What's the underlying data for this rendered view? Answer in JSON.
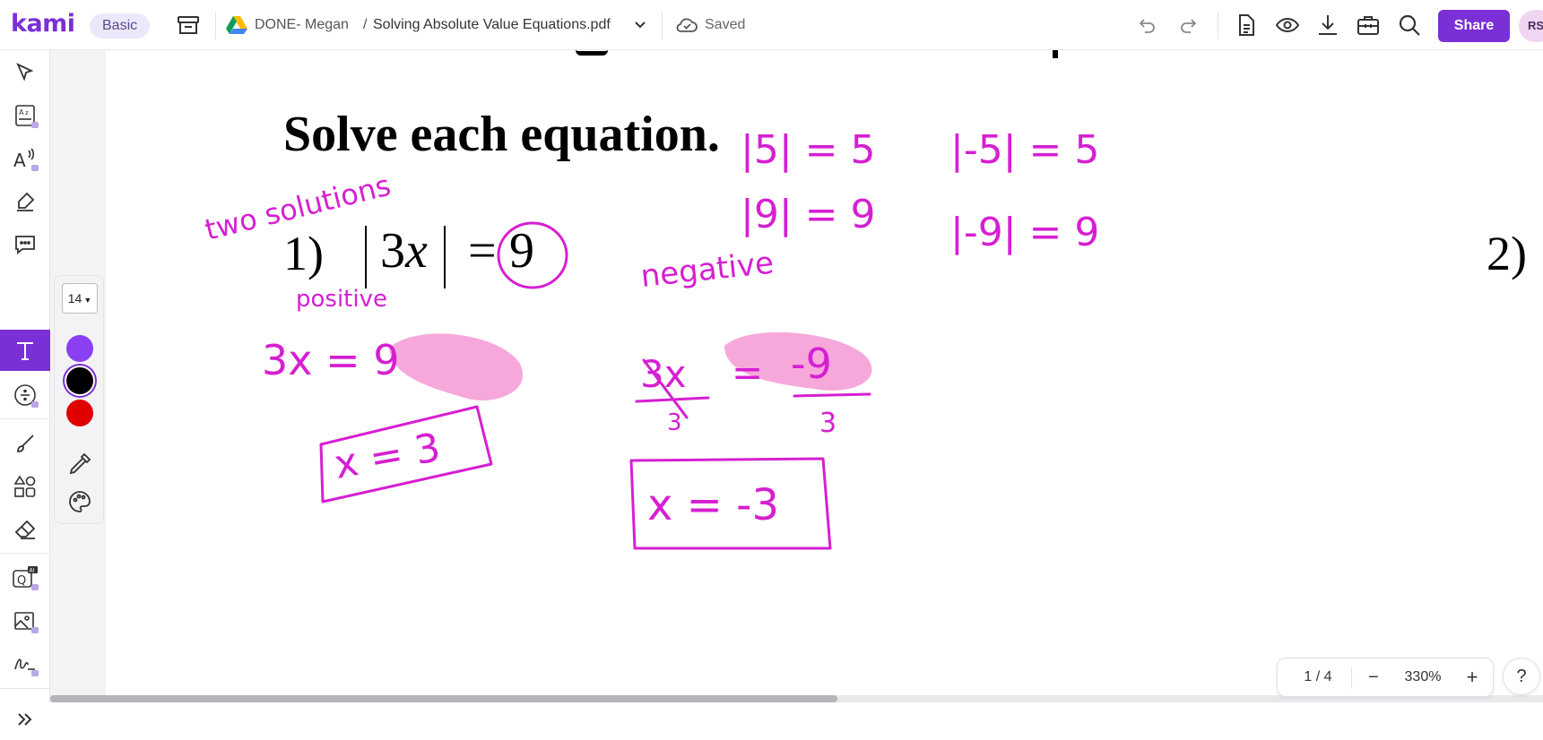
{
  "app": {
    "logo": "kami",
    "plan": "Basic"
  },
  "breadcrumb": {
    "folder": "DONE- Megan",
    "separator": "/",
    "file": "Solving Absolute Value Equations.pdf"
  },
  "status": {
    "saved": "Saved"
  },
  "header_actions": {
    "share_label": "Share",
    "avatar_initials": "RS",
    "icons": [
      "undo-icon",
      "redo-icon",
      "document-icon",
      "eye-icon",
      "download-icon",
      "toolbox-icon",
      "search-icon"
    ]
  },
  "left_toolbar": {
    "active": "text-tool",
    "items": [
      "select-tool",
      "dictionary-tool",
      "read-aloud-tool",
      "markup-tool",
      "comment-tool",
      "text-tool",
      "equation-tool",
      "draw-tool",
      "shapes-tool",
      "eraser-tool",
      "ai-question-tool",
      "image-tool",
      "signature-tool",
      "expand-toolbar"
    ]
  },
  "text_options": {
    "font_size": "14",
    "colors": [
      {
        "name": "purple",
        "hex": "#8a3ff0"
      },
      {
        "name": "black",
        "hex": "#000000",
        "selected": true
      },
      {
        "name": "red",
        "hex": "#e00000"
      }
    ]
  },
  "document": {
    "heading": "Solve each equation.",
    "problem1": {
      "number": "1)",
      "expr_coef": "3",
      "expr_var": "x",
      "eq": "=",
      "rhs": "9"
    },
    "problem2": {
      "number": "2)"
    },
    "ink_color": "#d61fd2",
    "highlight_color": "#f7a8da",
    "handwriting": {
      "two_solutions": "two solutions",
      "abs_examples": [
        "|5| = 5",
        "|-5| = 5",
        "|9| = 9",
        "|-9| = 9"
      ],
      "positive_label": "positive",
      "positive_eq": "3x =  9",
      "positive_answer": "x = 3",
      "negative_label": "negative",
      "negative_eq_left": "3x",
      "negative_eq_mid": "=",
      "negative_eq_right": "-9",
      "negative_divisor_left": "3",
      "negative_divisor_right": "3",
      "negative_answer": "x = -3"
    }
  },
  "page_controls": {
    "page_indicator": "1 / 4",
    "zoom_out": "−",
    "zoom_level": "330%",
    "zoom_in": "+",
    "help": "?"
  }
}
